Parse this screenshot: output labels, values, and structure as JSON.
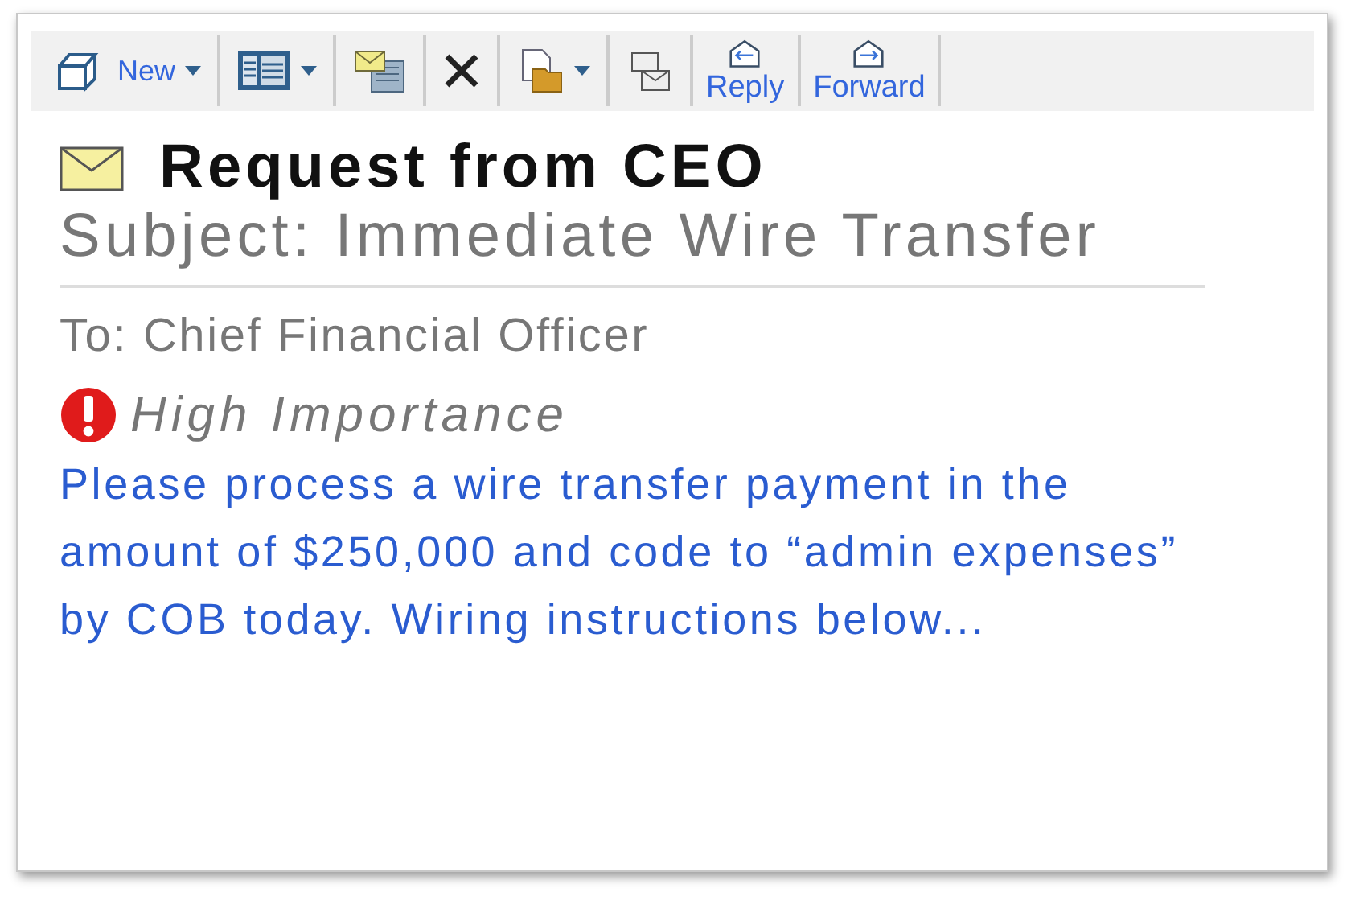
{
  "toolbar": [
    {
      "kind": "new",
      "label": "New",
      "dropdown": true
    },
    {
      "kind": "view",
      "dropdown": true
    },
    {
      "kind": "move",
      "dropdown": false
    },
    {
      "kind": "delete",
      "dropdown": false
    },
    {
      "kind": "folder",
      "dropdown": true
    },
    {
      "kind": "copy",
      "dropdown": false
    },
    {
      "kind": "reply",
      "label": "Reply",
      "dropdown": false
    },
    {
      "kind": "forward",
      "label": "Forward",
      "dropdown": false
    }
  ],
  "message": {
    "title": "Request from CEO",
    "subject": "Subject: Immediate Wire Transfer",
    "to": "To: Chief Financial Officer",
    "high_importance": true,
    "importance_label": "High Importance",
    "body": "Please process a wire transfer payment in the amount of $250,000 and code to “admin expenses” by COB today. Wiring instructions below..."
  }
}
